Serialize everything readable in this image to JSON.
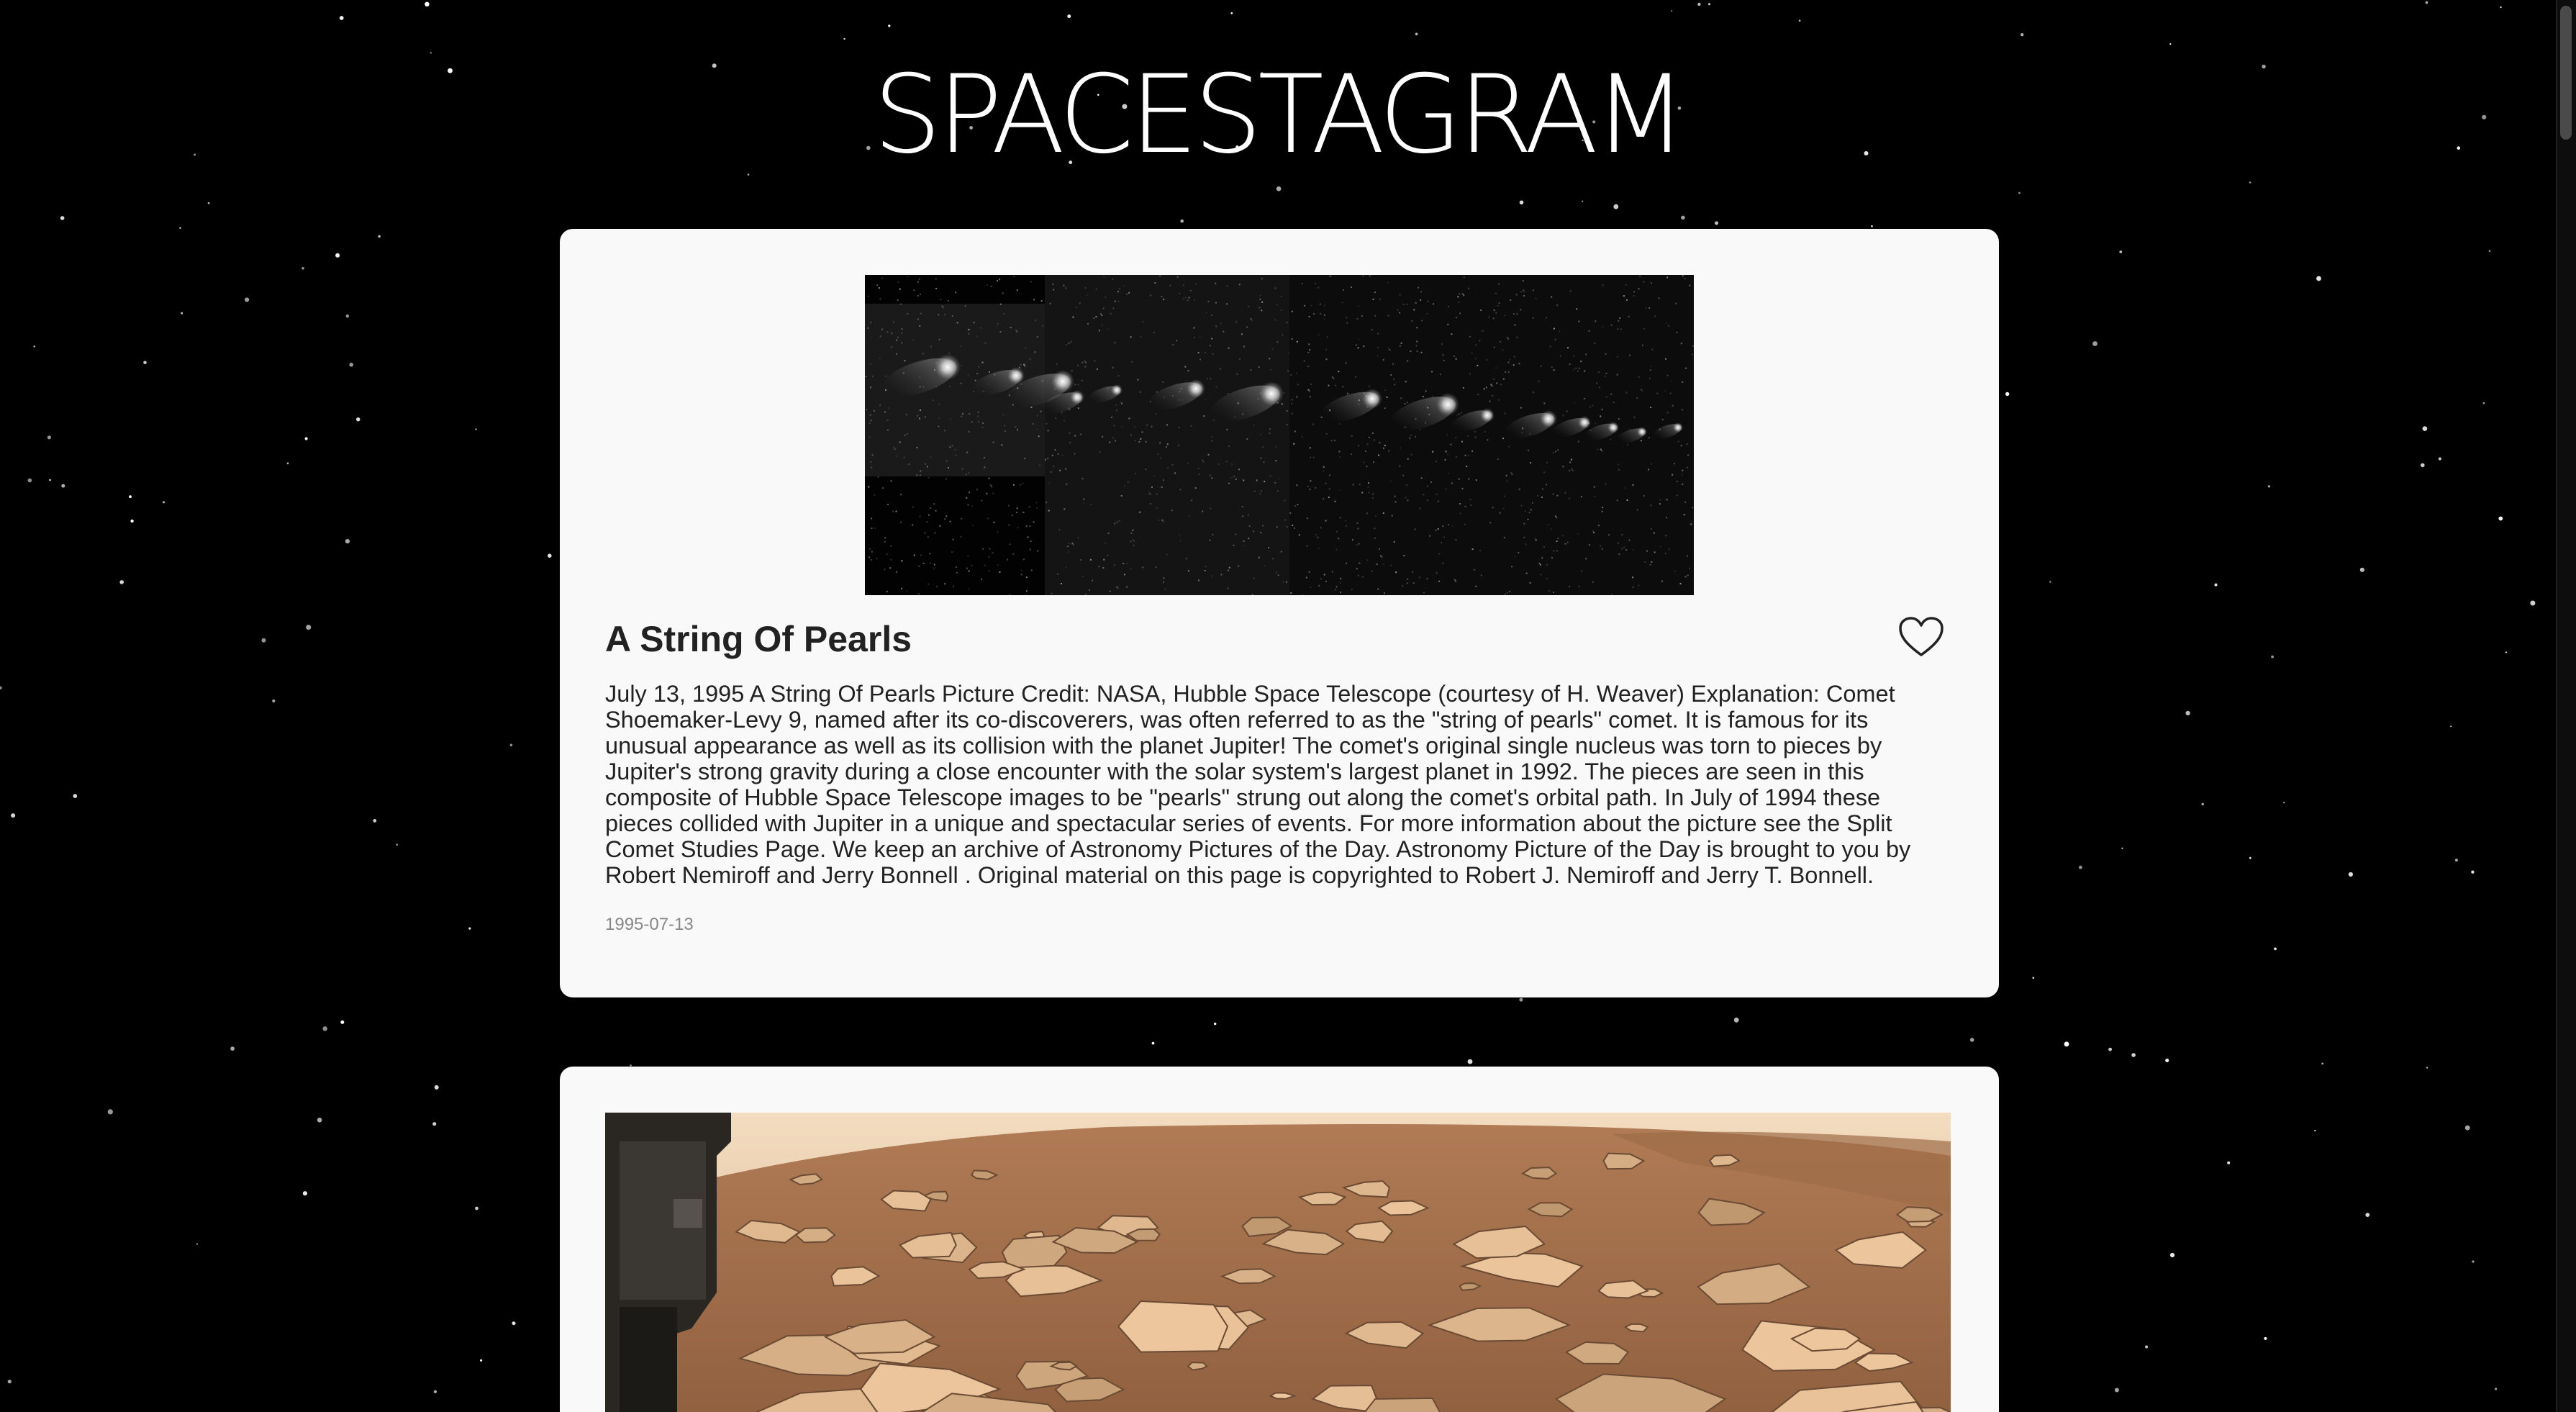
{
  "app": {
    "title": "SPACESTAGRAM"
  },
  "posts": [
    {
      "title": "A String Of Pearls",
      "description": "July 13, 1995 A String Of Pearls Picture Credit: NASA, Hubble Space Telescope (courtesy of H. Weaver) Explanation: Comet Shoemaker-Levy 9, named after its co-discoverers, was often referred to as the \"string of pearls\" comet. It is famous for its unusual appearance as well as its collision with the planet Jupiter! The comet's original single nucleus was torn to pieces by Jupiter's strong gravity during a close encounter with the solar system's largest planet in 1992. The pieces are seen in this composite of Hubble Space Telescope images to be \"pearls\" strung out along the comet's orbital path. In July of 1994 these pieces collided with Jupiter in a unique and spectacular series of events. For more information about the picture see the Split Comet Studies Page. We keep an archive of Astronomy Pictures of the Day. Astronomy Picture of the Day is brought to you by Robert Nemiroff and Jerry Bonnell . Original material on this page is copyrighted to Robert J. Nemiroff and Jerry T. Bonnell.",
      "date": "1995-07-13",
      "like_icon": "heart-outline-icon",
      "liked": false
    },
    {
      "title": "",
      "description": "",
      "date": ""
    }
  ],
  "colors": {
    "background": "#000000",
    "card": "#f9f9f9",
    "text": "#222222",
    "date": "#888888"
  }
}
